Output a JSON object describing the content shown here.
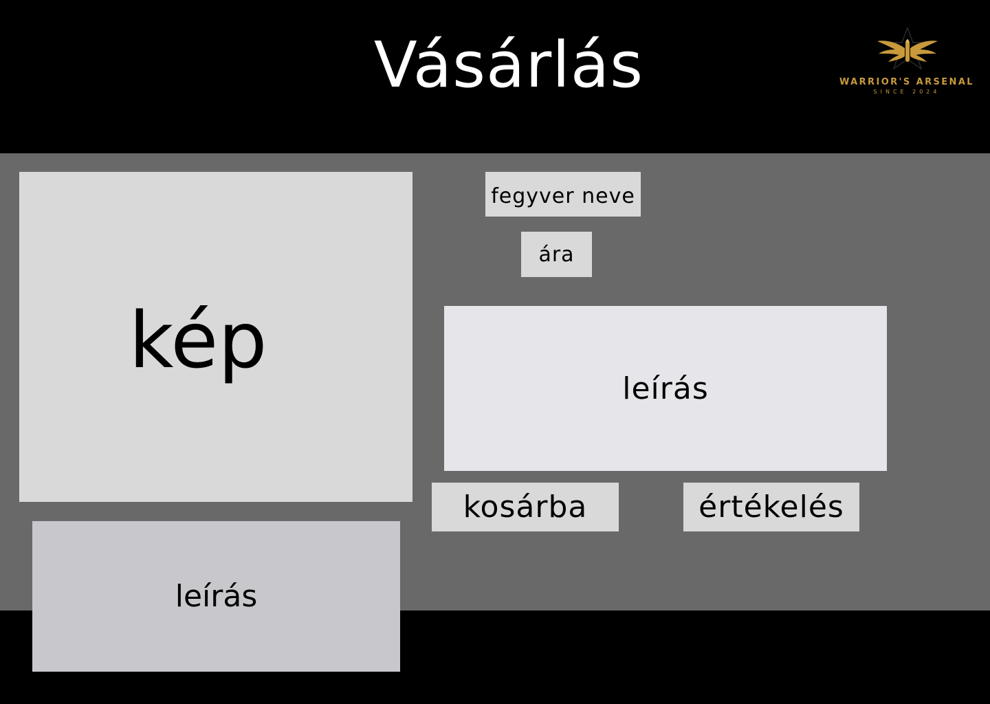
{
  "header": {
    "title": "Vásárlás",
    "logo": {
      "name": "WARRIOR'S ARSENAL",
      "since": "SINCE 2024",
      "icon": "winged-bullet-star-icon",
      "color": "#c89a3c"
    }
  },
  "product": {
    "image_placeholder": "kép",
    "name_placeholder": "fegyver neve",
    "price_placeholder": "ára",
    "description_placeholder": "leírás"
  },
  "actions": {
    "add_to_cart_label": "kosárba",
    "rating_label": "értékelés"
  },
  "lower": {
    "description_placeholder": "leírás"
  },
  "colors": {
    "header_bg": "#000000",
    "main_bg": "#696969",
    "image_box": "#d9d9d9",
    "description_box": "#e5e5ea",
    "lower_description_box": "#c7c7cc"
  }
}
